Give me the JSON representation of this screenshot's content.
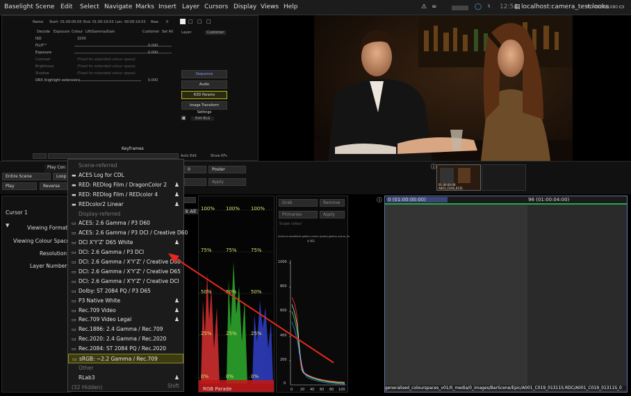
{
  "menubar": {
    "items": [
      "Baselight",
      "Scene",
      "Edit",
      "Select",
      "Navigate",
      "Marks",
      "Insert",
      "Layer",
      "Cursors",
      "Display",
      "Views",
      "Help"
    ],
    "time": "12:54",
    "host": "localhost:camera_test:looks",
    "format": "HD 1920x1080"
  },
  "topleft": {
    "name_label": "Name:",
    "start_label": "Start:",
    "start_value": "01:00:00:00",
    "end_label": "End:",
    "end_value": "01:00:19:03",
    "len_label": "Len:",
    "len_value": "00:00:19:03",
    "row_label": "Row:",
    "row_value": "0",
    "layer_label": "Layer:",
    "layer_value": "Customer",
    "tabs": [
      "Decode",
      "Exposure",
      "Colour",
      "Lift/Gamma/Gain"
    ],
    "customer": "Customer",
    "set_all": "Set All",
    "rows": [
      {
        "label": "ISO",
        "value": "3200"
      },
      {
        "label": "FLUT™",
        "value": "0.000"
      },
      {
        "label": "Exposure",
        "value": "0.000"
      },
      {
        "label": "Contrast",
        "value": "(Fixed for extended colour space)"
      },
      {
        "label": "Brightness",
        "value": "(Fixed for extended colour space)"
      },
      {
        "label": "Shadow",
        "value": "(Fixed for extended colour space)"
      },
      {
        "label": "DRX (highlight extension)",
        "value": "0.000"
      }
    ],
    "side_buttons": [
      "Sequence",
      "Audio",
      "R3D Params",
      "Image Transform Settings"
    ],
    "edit_btn": "Edit BLG",
    "keyframes": "Keyframes",
    "auto_edit": "Auto Edit",
    "show_kfs": "Show KFs"
  },
  "strip": {
    "play_controls": "Play Con",
    "entire_scene": "Entire Scene",
    "loop": "Loop",
    "play": "Play",
    "reverse": "Reverse",
    "frame": "0",
    "poster": "Poster",
    "apply": "Apply",
    "thumb_tc": "01:00:00:00",
    "thumb_name": "A001_C019_0131"
  },
  "infopanel": {
    "cursor": "Cursor 1",
    "viewing_format": "Viewing Format:",
    "viewing_colour_space": "Viewing Colour Space:",
    "resolution": "Resolution:",
    "layer_number": "Layer Number:",
    "link_all": "k All"
  },
  "dropdown": {
    "items": [
      {
        "text": "Scene-referred",
        "kind": "section",
        "icon": "",
        "person": false
      },
      {
        "text": "ACES Log for CDL",
        "kind": "item",
        "icon": "film-icon",
        "person": false
      },
      {
        "text": "RED: REDlog Film / DragonColor 2",
        "kind": "item",
        "icon": "film-icon",
        "person": true
      },
      {
        "text": "RED: REDlog Film / REDcolor 4",
        "kind": "item",
        "icon": "film-icon",
        "person": true
      },
      {
        "text": "REDcolor2 Linear",
        "kind": "item",
        "icon": "film-icon",
        "person": true
      },
      {
        "text": "Display-referred",
        "kind": "section",
        "icon": "",
        "person": false
      },
      {
        "text": "ACES: 2.6 Gamma / P3 D60",
        "kind": "item",
        "icon": "monitor-icon",
        "person": false
      },
      {
        "text": "ACES: 2.6 Gamma / P3 DCI / Creative D60",
        "kind": "item",
        "icon": "monitor-icon",
        "person": false
      },
      {
        "text": "DCI X'Y'Z' D65 White",
        "kind": "item",
        "icon": "monitor-icon",
        "person": true
      },
      {
        "text": "DCI: 2.6 Gamma / P3 DCI",
        "kind": "item",
        "icon": "monitor-icon",
        "person": false
      },
      {
        "text": "DCI: 2.6 Gamma / X'Y'Z' / Creative D60",
        "kind": "item",
        "icon": "monitor-icon",
        "person": false
      },
      {
        "text": "DCI: 2.6 Gamma / X'Y'Z' / Creative D65",
        "kind": "item",
        "icon": "monitor-icon",
        "person": false
      },
      {
        "text": "DCI: 2.6 Gamma / X'Y'Z' / Creative DCI",
        "kind": "item",
        "icon": "monitor-icon",
        "person": false
      },
      {
        "text": "Dolby: ST 2084 PQ / P3 D65",
        "kind": "item",
        "icon": "monitor-icon",
        "person": false
      },
      {
        "text": "P3 Native White",
        "kind": "item",
        "icon": "monitor-icon",
        "person": true
      },
      {
        "text": "Rec.709 Video",
        "kind": "item",
        "icon": "monitor-icon",
        "person": true
      },
      {
        "text": "Rec.709 Video Legal",
        "kind": "item",
        "icon": "monitor-icon",
        "person": true
      },
      {
        "text": "Rec.1886: 2.4 Gamma / Rec.709",
        "kind": "item",
        "icon": "monitor-icon",
        "person": false
      },
      {
        "text": "Rec.2020: 2.4 Gamma / Rec.2020",
        "kind": "item",
        "icon": "monitor-icon",
        "person": false
      },
      {
        "text": "Rec.2084: ST 2084 PQ / Rec.2020",
        "kind": "item",
        "icon": "monitor-icon",
        "person": false
      },
      {
        "text": "sRGB: ~2.2 Gamma / Rec.709",
        "kind": "selected",
        "icon": "monitor-icon",
        "person": false
      },
      {
        "text": "Other",
        "kind": "section",
        "icon": "",
        "person": false
      },
      {
        "text": "RLab3",
        "kind": "item",
        "icon": "",
        "person": true
      },
      {
        "text": "(32 Hidden)",
        "kind": "hidden",
        "icon": "",
        "person": false
      }
    ],
    "shift": "Shift"
  },
  "scope1": {
    "labels_100": [
      "100%",
      "100%",
      "100%"
    ],
    "labels_75": [
      "75%",
      "75%",
      "75%"
    ],
    "labels_50": [
      "50%",
      "50%",
      "50%"
    ],
    "labels_25": [
      "25%",
      "25%",
      "25%"
    ],
    "labels_0": [
      "0%",
      "0%",
      "0%"
    ],
    "footer": "RGB Parade"
  },
  "scope2": {
    "grab": "Grab",
    "remove": "Remove",
    "primaries": "Primaries",
    "apply": "Apply",
    "scope_name": "Scope colour",
    "caption": "Scale to waveform gallery scene [scale] gallery scene_lm",
    "caption2": "$ NG",
    "y_ticks": [
      "1000",
      "800",
      "600",
      "400",
      "200",
      "0"
    ],
    "x_ticks": [
      "0",
      "20",
      "40",
      "60",
      "80",
      "100"
    ]
  },
  "timeline": {
    "start": "0 (01:00:00:00)",
    "end": "96 (01:00:04:00)",
    "clip": "generalised_colourspaces_v01/0_media/0_images/BarScene/Epic/A001_C019_01311S.RDC/A001_C019_01311S_0"
  },
  "colors": {
    "accent": "#3f6fd8",
    "selected_bg": "#3d3c10",
    "annotation": "#e8281e"
  }
}
